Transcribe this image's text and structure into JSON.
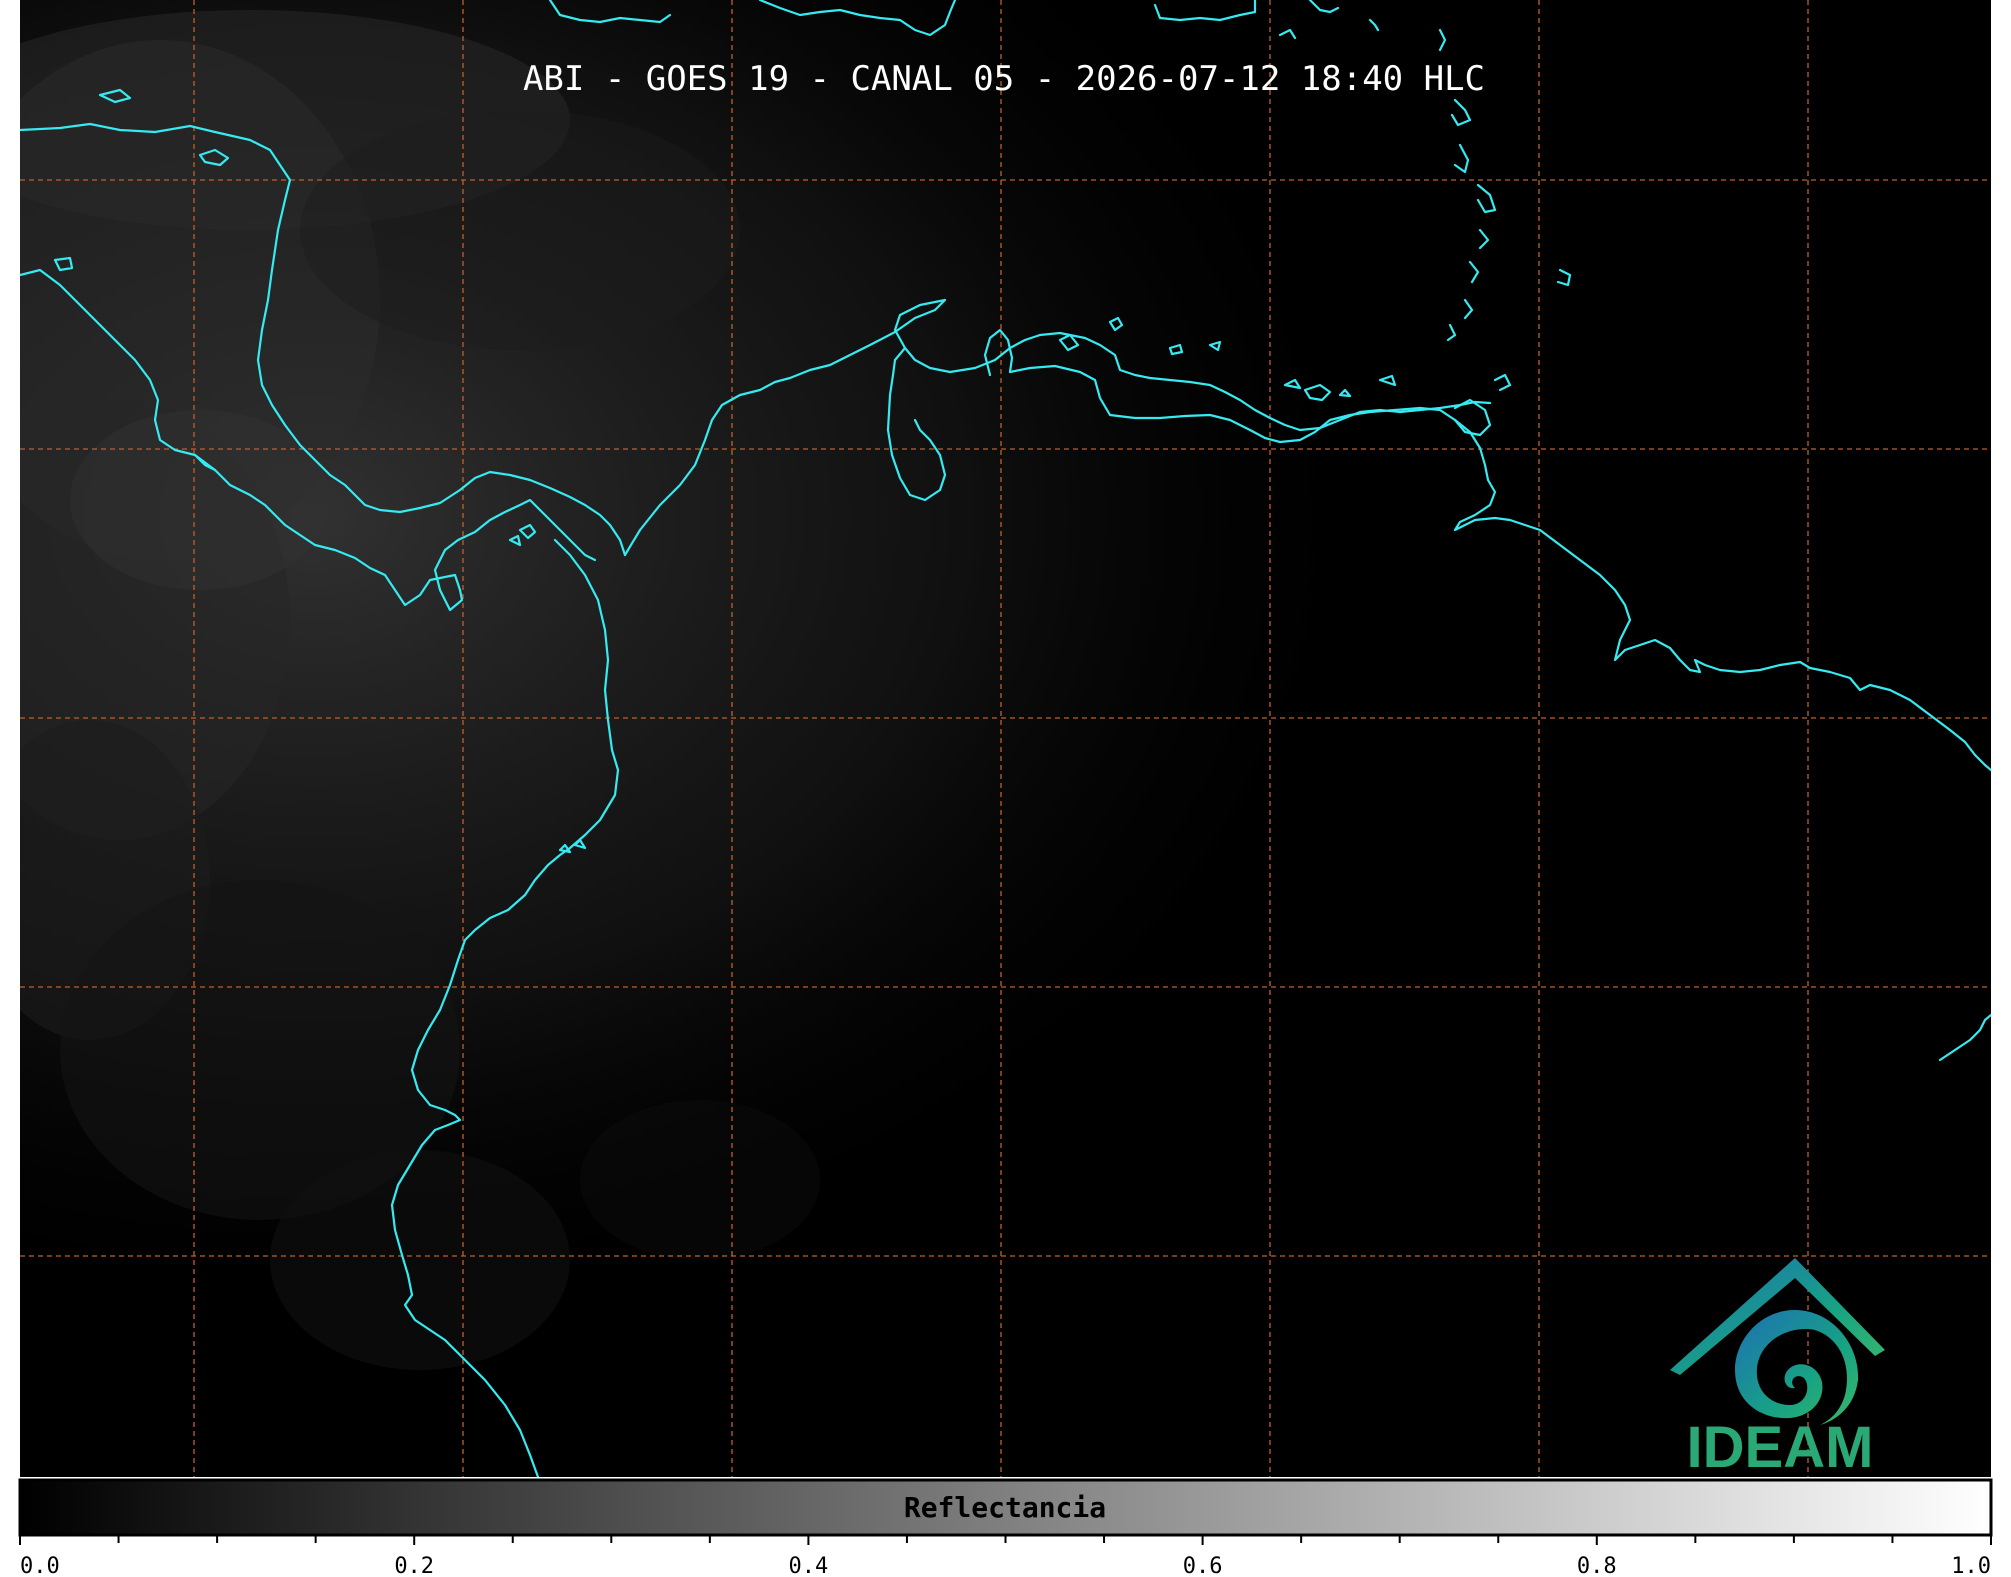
{
  "title": "ABI - GOES 19 - CANAL 05 - 2026-07-12 18:40 HLC",
  "colorbar": {
    "label": "Reflectancia",
    "min": 0.0,
    "max": 1.0,
    "ticks": [
      "0.0",
      "0.2",
      "0.4",
      "0.6",
      "0.8",
      "1.0"
    ],
    "minor_step": 0.05,
    "colormap": "grayscale",
    "color_low": "#000000",
    "color_high": "#ffffff"
  },
  "map": {
    "background_color": "#000000",
    "coastline_color": "#35eaf0",
    "gridline_color": "#c0602a",
    "gridlines": "dashed"
  },
  "logo": {
    "text": "IDEAM",
    "colors": [
      "#1e6fb5",
      "#17a383",
      "#3bb86a"
    ]
  }
}
